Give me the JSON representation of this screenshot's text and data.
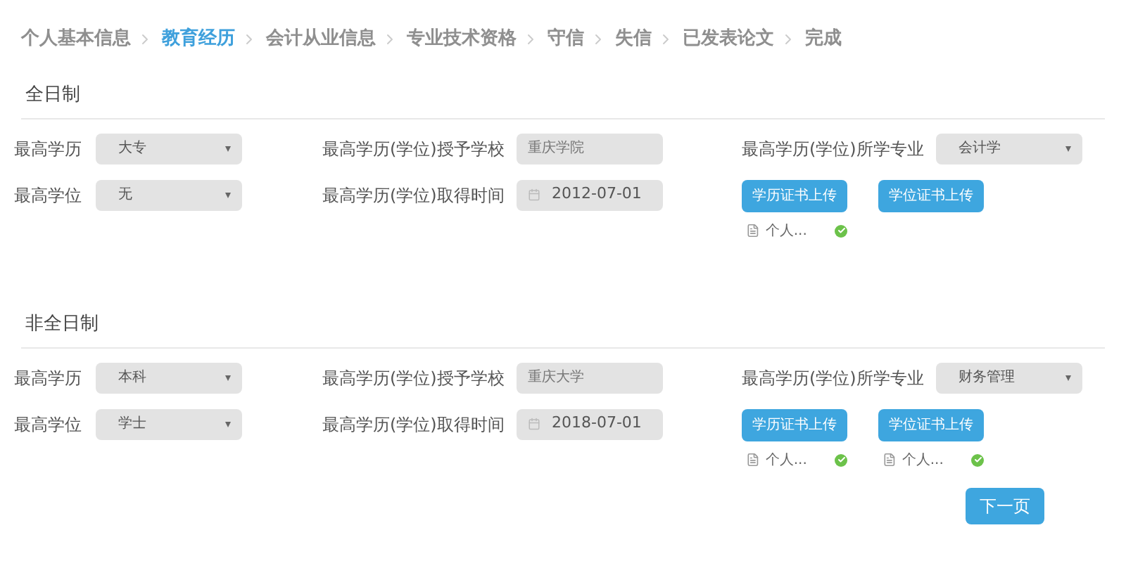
{
  "steps": [
    {
      "label": "个人基本信息",
      "selected": false
    },
    {
      "label": "教育经历",
      "selected": true
    },
    {
      "label": "会计从业信息",
      "selected": false
    },
    {
      "label": "专业技术资格",
      "selected": false
    },
    {
      "label": "守信",
      "selected": false
    },
    {
      "label": "失信",
      "selected": false
    },
    {
      "label": "已发表论文",
      "selected": false
    },
    {
      "label": "完成",
      "selected": false
    }
  ],
  "sections": [
    {
      "title": "全日制",
      "education": {
        "label": "最高学历",
        "value": "大专"
      },
      "degree": {
        "label": "最高学位",
        "value": "无"
      },
      "school": {
        "label": "最高学历(学位)授予学校",
        "value": "重庆学院"
      },
      "date": {
        "label": "最高学历(学位)取得时间",
        "value": "2012-07-01"
      },
      "major": {
        "label": "最高学历(学位)所学专业",
        "value": "会计学"
      },
      "uploads": [
        {
          "label": "学历证书上传",
          "files": [
            {
              "name": "个人..."
            }
          ]
        },
        {
          "label": "学位证书上传"
        }
      ]
    },
    {
      "title": "非全日制",
      "education": {
        "label": "最高学历",
        "value": "本科"
      },
      "degree": {
        "label": "最高学位",
        "value": "学士"
      },
      "school": {
        "label": "最高学历(学位)授予学校",
        "value": "重庆大学"
      },
      "date": {
        "label": "最高学历(学位)取得时间",
        "value": "2018-07-01"
      },
      "major": {
        "label": "最高学历(学位)所学专业",
        "value": "财务管理"
      },
      "uploads": [
        {
          "label": "学历证书上传",
          "files": [
            {
              "name": "个人..."
            }
          ]
        },
        {
          "label": "学位证书上传",
          "files": [
            {
              "name": "个人..."
            }
          ]
        }
      ]
    }
  ],
  "next_button": "下一页"
}
